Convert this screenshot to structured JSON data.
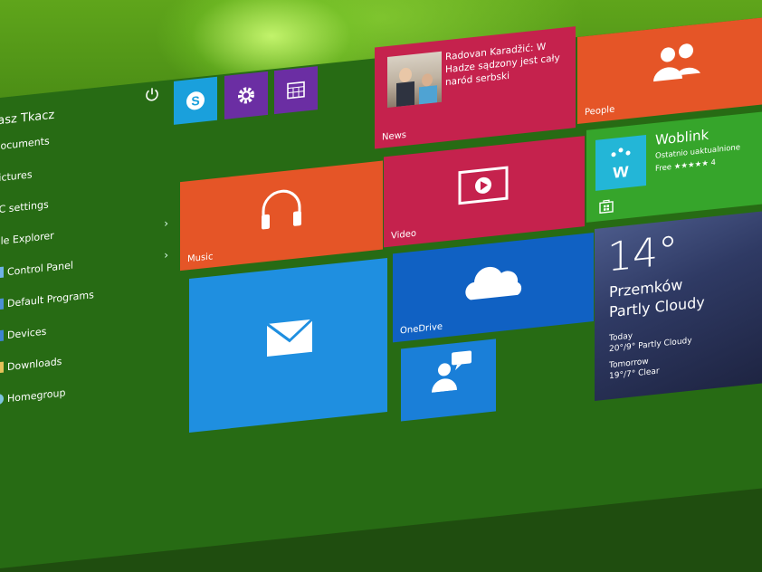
{
  "user": {
    "name": "kasz Tkacz"
  },
  "menu": [
    {
      "label": "Documents",
      "chevron": false
    },
    {
      "label": "Pictures",
      "chevron": false
    },
    {
      "label": "PC settings",
      "chevron": false
    },
    {
      "label": "File Explorer",
      "chevron": true
    },
    {
      "label": "Control Panel",
      "chevron": true
    },
    {
      "label": "Default Programs",
      "chevron": false
    },
    {
      "label": "Devices",
      "chevron": false
    },
    {
      "label": "Downloads",
      "chevron": false
    },
    {
      "label": "Homegroup",
      "chevron": false
    }
  ],
  "tiles": {
    "news": {
      "headline": "Radovan Karadžić: W Hadze sądzony jest cały naród serbski",
      "label": "News"
    },
    "video": {
      "label": "Video"
    },
    "music": {
      "label": "Music"
    },
    "onedrive": {
      "label": "OneDrive"
    },
    "people": {
      "label": "People"
    },
    "store": {
      "title": "Woblink",
      "subtitle": "Ostatnio uaktualnione",
      "rating": "Free ★★★★★ 4"
    },
    "weather": {
      "temp": "14°",
      "city": "Przemków",
      "condition": "Partly Cloudy",
      "today_label": "Today",
      "today": "20°/9° Partly Cloudy",
      "tomorrow_label": "Tomorrow",
      "tomorrow": "19°/7° Clear"
    }
  },
  "colors": {
    "panel": "#276b14",
    "tile_red": "#c5224d",
    "tile_orange": "#e55527",
    "tile_blue": "#1f8fe0",
    "tile_green": "#36a52b",
    "tile_purple": "#6b2ea3"
  }
}
